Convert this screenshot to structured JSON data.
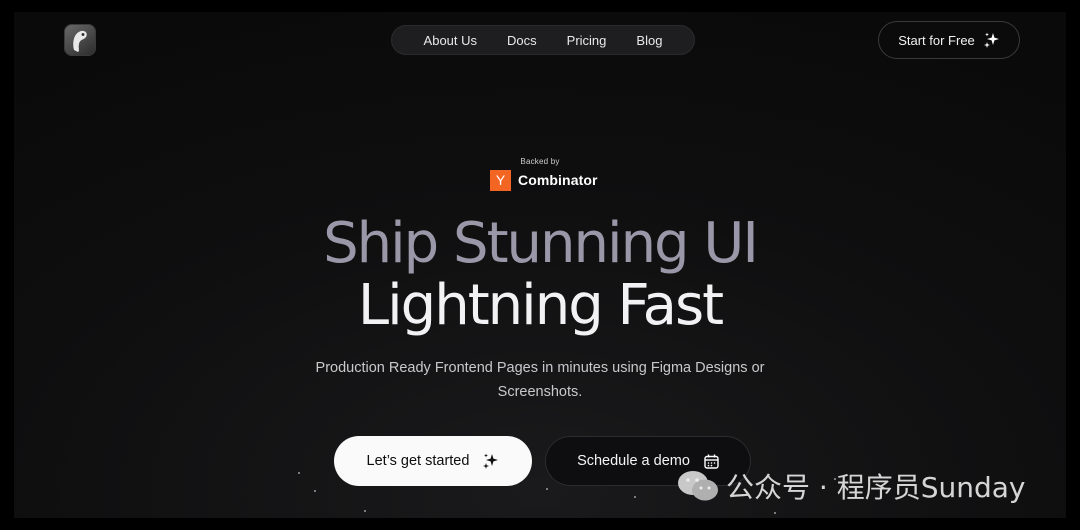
{
  "nav": {
    "items": [
      "About Us",
      "Docs",
      "Pricing",
      "Blog"
    ],
    "cta_label": "Start for Free"
  },
  "badge": {
    "backed_label": "Backed by",
    "yc_letter": "Y",
    "yc_name": "Combinator"
  },
  "hero": {
    "line1": "Ship Stunning UI",
    "line2": "Lightning Fast",
    "subtitle": "Production Ready Frontend Pages in minutes using Figma Designs or Screenshots."
  },
  "actions": {
    "primary_label": "Let’s get started",
    "secondary_label": "Schedule a demo"
  },
  "watermark": {
    "text": "公众号 · 程序员Sunday"
  },
  "colors": {
    "accent_yc": "#f26522",
    "background": "#0a0a0a",
    "hero_muted": "#9a98a8"
  }
}
